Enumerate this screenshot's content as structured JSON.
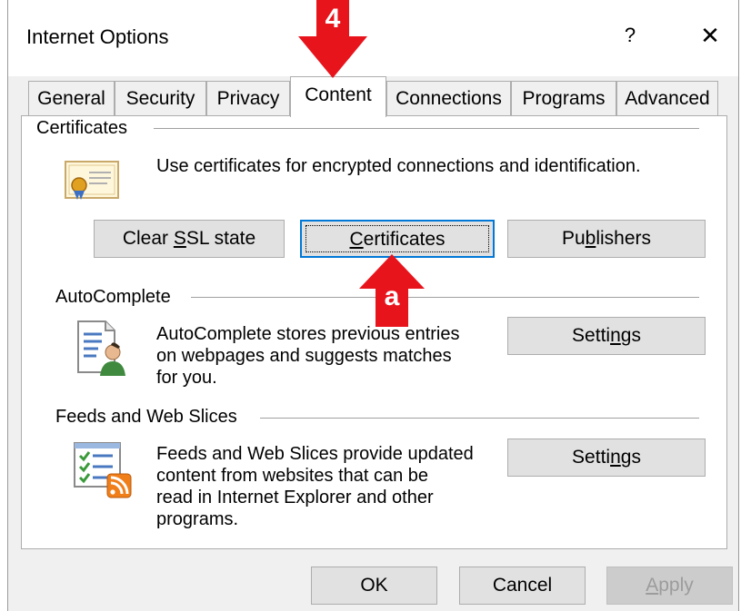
{
  "window": {
    "title": "Internet Options",
    "help_glyph": "?",
    "close_glyph": "✕"
  },
  "tabs": [
    {
      "label": "General"
    },
    {
      "label": "Security"
    },
    {
      "label": "Privacy"
    },
    {
      "label": "Content",
      "active": true
    },
    {
      "label": "Connections"
    },
    {
      "label": "Programs"
    },
    {
      "label": "Advanced"
    }
  ],
  "certificates": {
    "group_title": "Certificates",
    "description": "Use certificates for encrypted connections and identification.",
    "buttons": {
      "clear_ssl_pre": "Clear ",
      "clear_ssl_ul": "S",
      "clear_ssl_post": "SL state",
      "certs_ul": "C",
      "certs_post": "ertificates",
      "publishers_pre": "Pu",
      "publishers_ul": "b",
      "publishers_post": "lishers"
    }
  },
  "autocomplete": {
    "group_title": "AutoComplete",
    "description_lines": [
      "AutoComplete stores previous entries",
      "on webpages and suggests matches",
      "for you."
    ],
    "settings_pre": "Setti",
    "settings_ul": "n",
    "settings_post": "gs"
  },
  "feeds": {
    "group_title": "Feeds and Web Slices",
    "description_lines": [
      "Feeds and Web Slices provide updated",
      "content from websites that can be",
      "read in Internet Explorer and other",
      "programs."
    ],
    "settings_pre": "Setti",
    "settings_ul": "n",
    "settings_post": "gs"
  },
  "footer": {
    "ok": "OK",
    "cancel": "Cancel",
    "apply_ul": "A",
    "apply_post": "pply"
  },
  "annotations": {
    "step_marker": "4",
    "sub_marker": "a",
    "color": "#e8141c"
  }
}
